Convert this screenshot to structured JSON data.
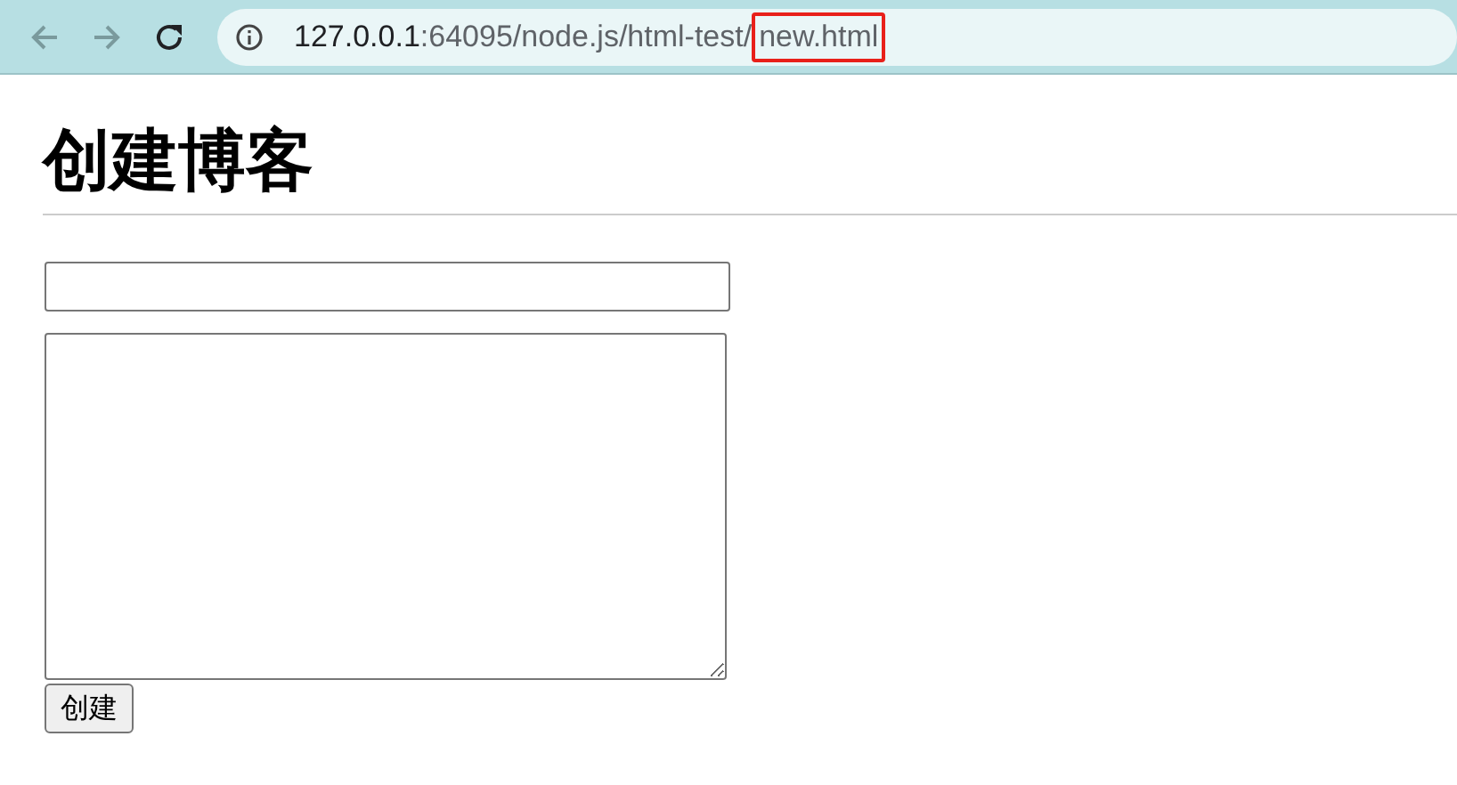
{
  "toolbar": {
    "back": {
      "disabled": true
    },
    "forward": {
      "disabled": true
    },
    "address": {
      "host": "127.0.0.1",
      "path": ":64095/node.js/html-test/",
      "highlighted_part": "new.html"
    }
  },
  "page": {
    "heading": "创建博客",
    "button": "创建"
  }
}
